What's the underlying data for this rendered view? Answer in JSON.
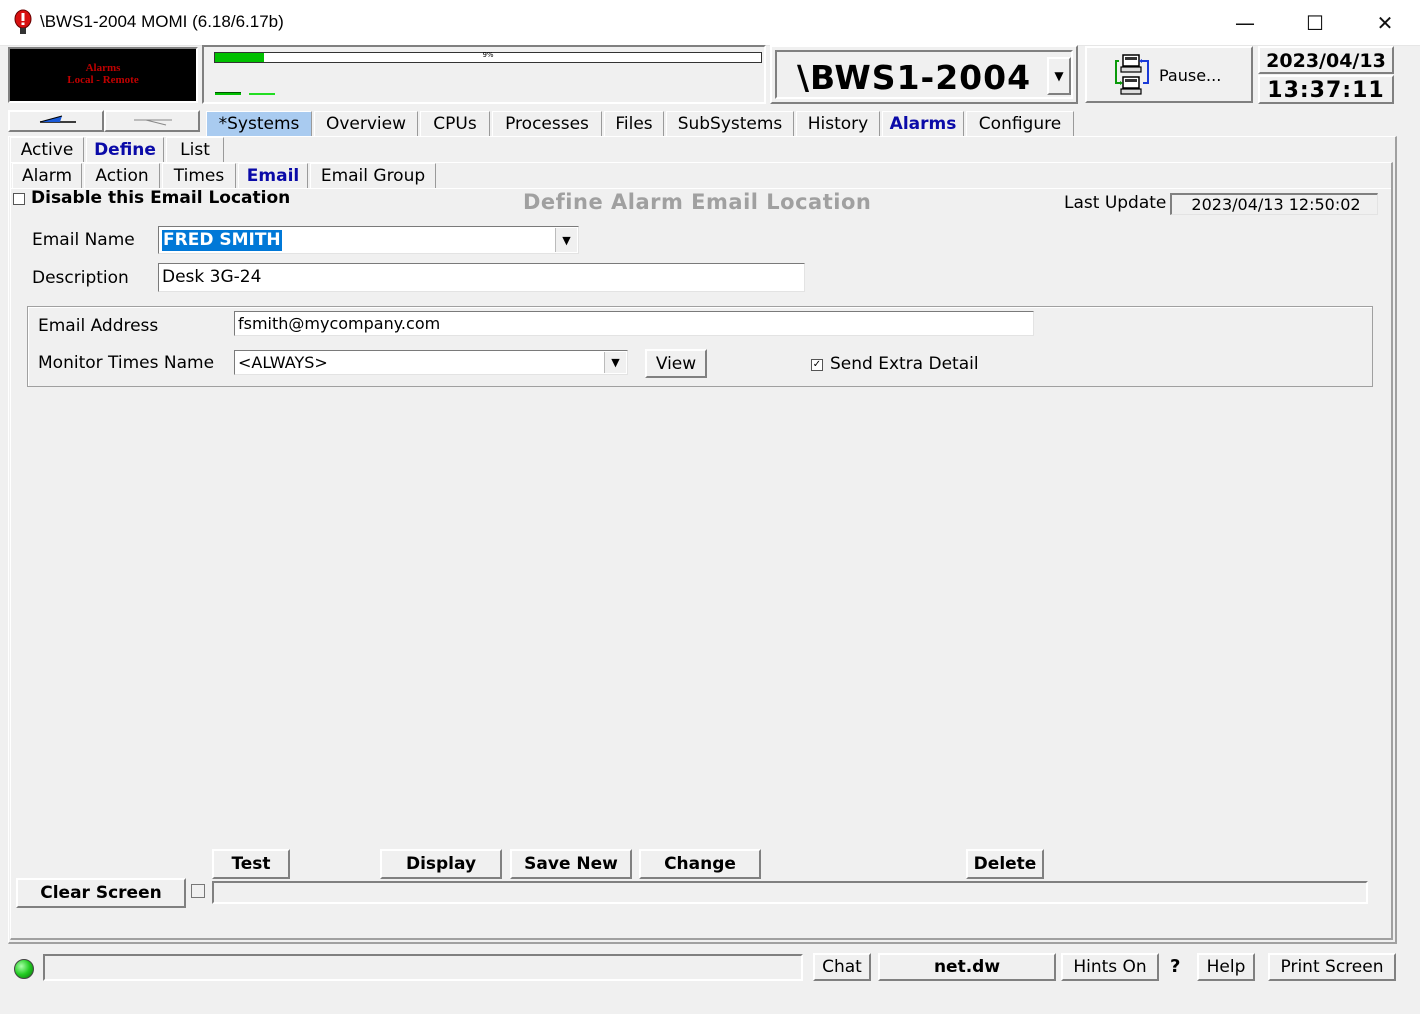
{
  "window": {
    "title": "\\BWS1-2004 MOMI (6.18/6.17b)",
    "controls": {
      "minimize": "—",
      "maximize": "☐",
      "close": "✕"
    }
  },
  "header": {
    "alarm_panel": {
      "line1": "Alarms",
      "line2": "Local - Remote",
      "color": "#c00000"
    },
    "gauge": {
      "percent_label": "9%",
      "value": 0.09,
      "color": "#00c000"
    },
    "system_name": "\\BWS1-2004",
    "pause_label": "Pause...",
    "date": "2023/04/13",
    "time": "13:37:11"
  },
  "main_tabs": [
    "*Systems",
    "Overview",
    "CPUs",
    "Processes",
    "Files",
    "SubSystems",
    "History",
    "Alarms",
    "Configure"
  ],
  "sub_tabs": [
    "Active",
    "Define",
    "List"
  ],
  "define_tabs": [
    "Alarm",
    "Action",
    "Times",
    "Email",
    "Email Group"
  ],
  "form": {
    "disable_label": "Disable this Email Location",
    "heading": "Define Alarm Email Location",
    "last_update_label": "Last Update",
    "last_update_value": "2023/04/13 12:50:02",
    "email_name_label": "Email Name",
    "email_name_value": "FRED SMITH",
    "description_label": "Description",
    "description_value": "Desk 3G-24",
    "email_address_label": "Email Address",
    "email_address_value": "fsmith@mycompany.com",
    "monitor_times_label": "Monitor Times Name",
    "monitor_times_value": "<ALWAYS>",
    "view_label": "View",
    "send_extra_label": "Send Extra Detail",
    "send_extra_checked": true
  },
  "actions": {
    "test": "Test",
    "display": "Display",
    "save_new": "Save New",
    "change": "Change",
    "delete": "Delete",
    "clear_screen": "Clear Screen"
  },
  "statusbar": {
    "chat": "Chat",
    "net": "net.dw",
    "hints": "Hints On",
    "question": "?",
    "help": "Help",
    "print": "Print Screen",
    "indicator_color": "#22cc22"
  },
  "colors": {
    "accent_tab": "#0a0aa8",
    "highlight_tab": "#a9cbf0",
    "selection": "#0078d7"
  }
}
